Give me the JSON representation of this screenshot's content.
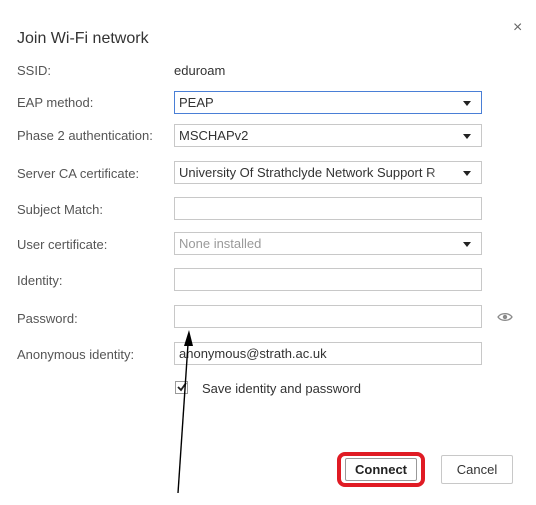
{
  "dialog": {
    "title": "Join Wi-Fi network",
    "close_glyph": "×",
    "close_icon": "close-icon"
  },
  "fields": {
    "ssid": {
      "label": "SSID:",
      "value": "eduroam"
    },
    "eap_method": {
      "label": "EAP method:",
      "value": "PEAP"
    },
    "phase2": {
      "label": "Phase 2 authentication:",
      "value": "MSCHAPv2"
    },
    "server_ca": {
      "label": "Server CA certificate:",
      "value": "University Of Strathclyde Network Support R"
    },
    "subject_match": {
      "label": "Subject Match:",
      "value": ""
    },
    "user_cert": {
      "label": "User certificate:",
      "value": "None installed"
    },
    "identity": {
      "label": "Identity:",
      "value": ""
    },
    "password": {
      "label": "Password:",
      "value": "",
      "show_icon": "eye-icon"
    },
    "anon_identity": {
      "label": "Anonymous identity:",
      "value": "anonymous@strath.ac.uk"
    }
  },
  "save": {
    "label": "Save identity and password",
    "checked": true
  },
  "buttons": {
    "connect": "Connect",
    "cancel": "Cancel"
  },
  "colors": {
    "focus": "#4a7fd6",
    "highlight": "#e01b24"
  }
}
